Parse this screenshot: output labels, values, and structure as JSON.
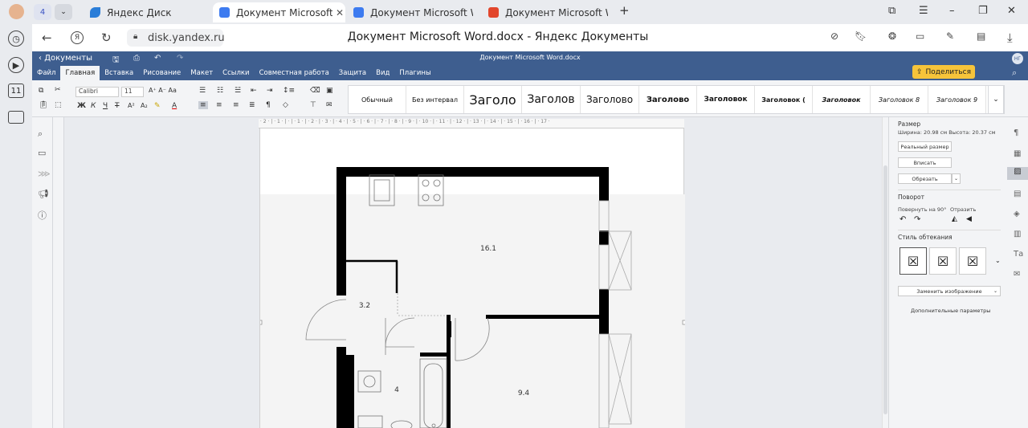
{
  "browser": {
    "tab_count": "4",
    "tabs": [
      {
        "title": "Яндекс Диск",
        "icon_color": "#2a7dd8"
      },
      {
        "title": "Документ Microsoft Word",
        "icon_color": "#3d7bf0"
      },
      {
        "title": "Документ Microsoft Word",
        "icon_color": "#3d7bf0"
      },
      {
        "title": "Документ Microsoft Word",
        "icon_color": "#e2462c"
      }
    ],
    "url": "disk.yandex.ru",
    "page_title": "Документ Microsoft Word.docx - Яндекс Документы",
    "rail_badge": "11"
  },
  "doc": {
    "back_label": "Документы",
    "file_name": "Документ Microsoft Word.docx",
    "menu": [
      "Файл",
      "Главная",
      "Вставка",
      "Рисование",
      "Макет",
      "Ссылки",
      "Совместная работа",
      "Защита",
      "Вид",
      "Плагины"
    ],
    "active_menu": "Главная",
    "share_label": "Поделиться",
    "avatar_initials": "НГ",
    "accent_color": "#3e5e8f"
  },
  "toolbar": {
    "font_name": "Calibri",
    "font_size": "11",
    "styles": [
      "Обычный",
      "Без интервал",
      "Заголо",
      "Заголов",
      "Заголово",
      "Заголово",
      "Заголовок",
      "Заголовок (",
      "Заголовок",
      "Заголовок 8",
      "Заголовок 9"
    ]
  },
  "floorplan": {
    "rooms": [
      {
        "label": "16.1"
      },
      {
        "label": "3.2"
      },
      {
        "label": "4"
      },
      {
        "label": "9.4"
      }
    ]
  },
  "panel": {
    "size_title": "Размер",
    "size_info": "Ширина: 20.98 см   Высота: 20.37 см",
    "real_size": "Реальный размер",
    "fit": "Вписать",
    "crop": "Обрезать",
    "rotation_title": "Поворот",
    "rotate_90": "Повернуть на 90°",
    "flip": "Отразить",
    "wrap_title": "Стиль обтекания",
    "replace_image": "Заменить изображение",
    "more_params": "Дополнительные параметры"
  }
}
